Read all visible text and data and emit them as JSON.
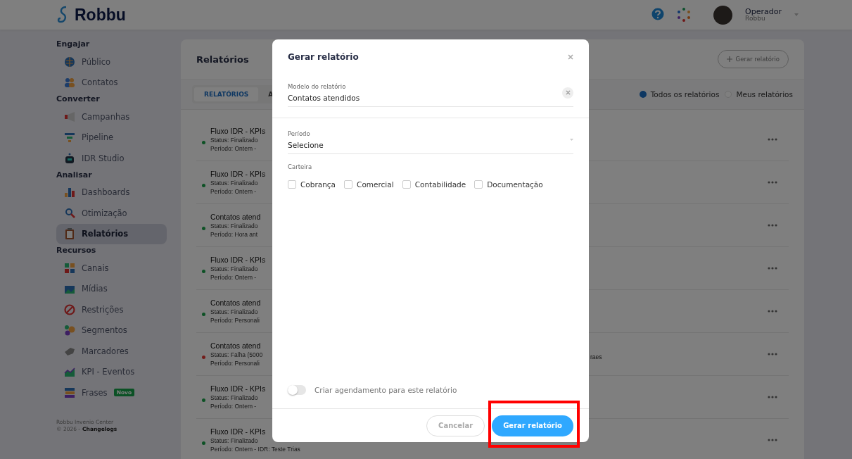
{
  "header": {
    "logo": "Robbu",
    "user": {
      "name": "Operador",
      "org": "Robbu"
    }
  },
  "sidebar": {
    "sections": [
      {
        "title": "Engajar",
        "items": [
          {
            "label": "Público",
            "selected": false
          },
          {
            "label": "Contatos",
            "selected": false
          }
        ]
      },
      {
        "title": "Converter",
        "items": [
          {
            "label": "Campanhas",
            "selected": false
          },
          {
            "label": "Pipeline",
            "selected": false
          },
          {
            "label": "IDR Studio",
            "selected": false
          }
        ]
      },
      {
        "title": "Analisar",
        "items": [
          {
            "label": "Dashboards",
            "selected": false
          },
          {
            "label": "Otimização",
            "selected": false
          },
          {
            "label": "Relatórios",
            "selected": true
          }
        ]
      },
      {
        "title": "Recursos",
        "items": [
          {
            "label": "Canais",
            "selected": false
          },
          {
            "label": "Mídias",
            "selected": false
          },
          {
            "label": "Restrições",
            "selected": false
          },
          {
            "label": "Segmentos",
            "selected": false
          },
          {
            "label": "Marcadores",
            "selected": false
          },
          {
            "label": "KPI - Eventos",
            "selected": false
          },
          {
            "label": "Frases",
            "selected": false,
            "badge": "Novo"
          }
        ]
      }
    ],
    "footer": {
      "product": "Robbu Invenio Center",
      "copyright": "© 2026 -",
      "link": "Changelogs"
    }
  },
  "main": {
    "title": "Relatórios",
    "new_button": "Gerar relatório",
    "tabs": [
      {
        "label": "RELATÓRIOS",
        "selected": true
      },
      {
        "label": "A",
        "selected": false
      }
    ],
    "filters": [
      {
        "label": "Todos os relatórios",
        "selected": true
      },
      {
        "label": "Meus relatórios",
        "selected": false
      }
    ],
    "rows": [
      {
        "title": "Fluxo IDR - KPIs",
        "status": "Status: Finalizado",
        "period": "Período: Ontem  -",
        "kind": "done"
      },
      {
        "title": "Fluxo IDR - KPIs",
        "status": "Status: Finalizado",
        "period": "Período: Ontem  -",
        "kind": "done"
      },
      {
        "title": "Contatos atend",
        "status": "Status: Finalizado",
        "period": "Período: Hora ant",
        "kind": "done"
      },
      {
        "title": "Fluxo IDR - KPIs",
        "status": "Status: Finalizado",
        "period": "Período: Ontem  -",
        "kind": "done"
      },
      {
        "title": "Contatos atend",
        "status": "Status: Finalizado",
        "period": "Período: Personali",
        "kind": "done"
      },
      {
        "title": "Contatos atend",
        "status": "Status: Falha (5000",
        "period": "Período: Personali",
        "kind": "failed",
        "extra": "raes"
      },
      {
        "title": "Fluxo IDR - KPIs",
        "status": "Status: Finalizado",
        "period": "Período: Ontem  -",
        "kind": "done"
      },
      {
        "title": "Fluxo IDR - KPIs",
        "status": "Status: Finalizado",
        "period": "Período: Ontem  - IDR: Teste Trias",
        "kind": "done"
      }
    ]
  },
  "modal": {
    "title": "Gerar relatório",
    "model": {
      "label": "Modelo do relatório",
      "value": "Contatos atendidos"
    },
    "period": {
      "label": "Período",
      "value": "Selecione"
    },
    "wallet": {
      "label": "Carteira",
      "options": [
        {
          "label": "Cobrança",
          "checked": false
        },
        {
          "label": "Comercial",
          "checked": false
        },
        {
          "label": "Contabilidade",
          "checked": false
        },
        {
          "label": "Documentação",
          "checked": false
        }
      ]
    },
    "schedule": {
      "label": "Criar agendamento para este relatório",
      "on": false
    },
    "buttons": [
      {
        "label": "Cancelar",
        "kind": "secondary"
      },
      {
        "label": "Gerar relatório",
        "kind": "primary",
        "highlighted": true
      }
    ]
  }
}
